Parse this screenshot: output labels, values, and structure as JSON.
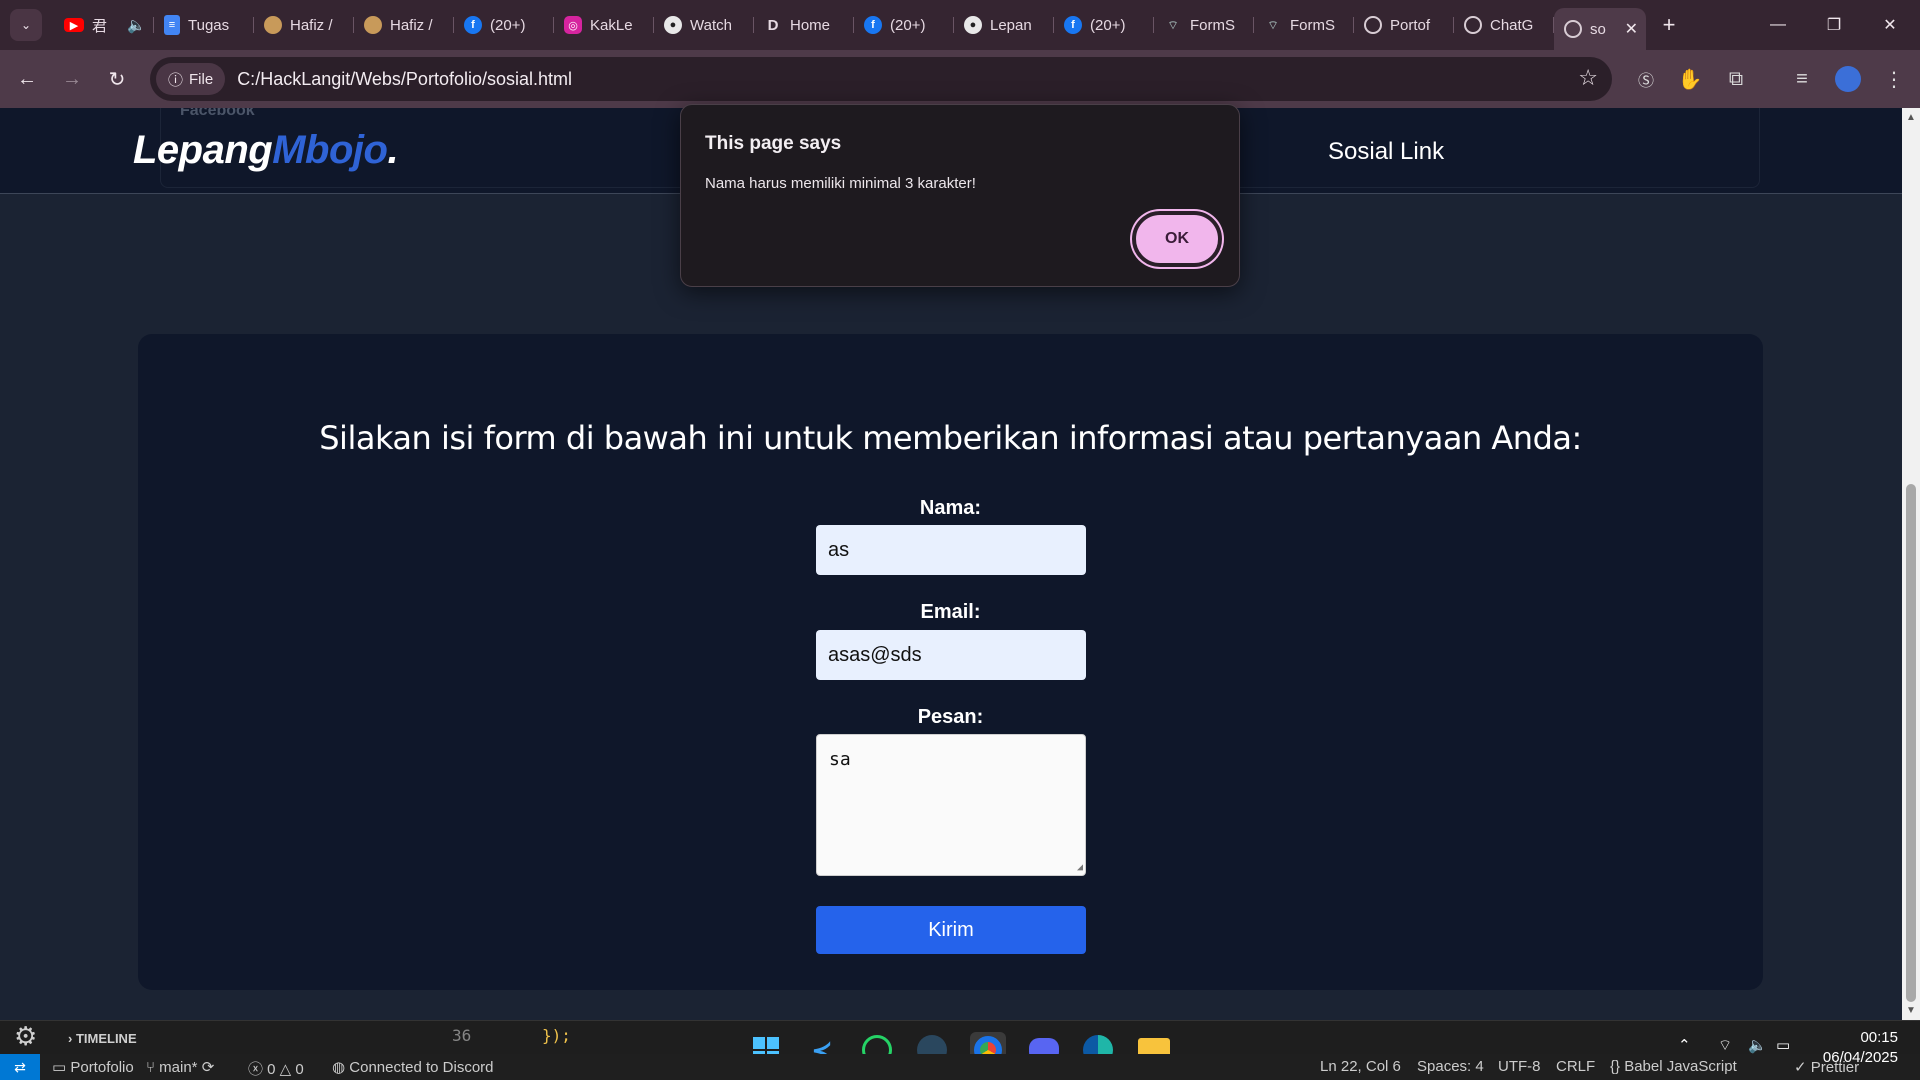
{
  "browser": {
    "tabs": [
      {
        "label": "君",
        "icon": "youtube-icon",
        "audio": true
      },
      {
        "label": "Tugas",
        "icon": "google-docs-icon"
      },
      {
        "label": "Hafiz /",
        "icon": "avatar-icon"
      },
      {
        "label": "Hafiz /",
        "icon": "avatar-icon"
      },
      {
        "label": "(20+)",
        "icon": "facebook-icon"
      },
      {
        "label": "KakLe",
        "icon": "instagram-icon"
      },
      {
        "label": "Watch",
        "icon": "github-icon"
      },
      {
        "label": "Home",
        "icon": "d-icon"
      },
      {
        "label": "(20+)",
        "icon": "facebook-icon"
      },
      {
        "label": "Lepan",
        "icon": "github-icon"
      },
      {
        "label": "(20+)",
        "icon": "facebook-icon"
      },
      {
        "label": "FormS",
        "icon": "form-icon"
      },
      {
        "label": "FormS",
        "icon": "form-icon"
      },
      {
        "label": "Portof",
        "icon": "globe-icon"
      },
      {
        "label": "ChatG",
        "icon": "chatgpt-icon"
      },
      {
        "label": "so",
        "icon": "globe-icon",
        "active": true
      }
    ],
    "address": {
      "scheme_chip": "File",
      "url": "C:/HackLangit/Webs/Portofolio/sosial.html"
    }
  },
  "page": {
    "logo": {
      "part1": "Lepang",
      "part2": "Mbojo",
      "part3": "."
    },
    "ghost_text": "Facebook",
    "nav_link": "Sosial Link",
    "heading": "Silakan isi form di bawah ini untuk memberikan informasi atau pertanyaan Anda:",
    "form": {
      "name_label": "Nama:",
      "name_value": "as",
      "email_label": "Email:",
      "email_value": "asas@sds",
      "message_label": "Pesan:",
      "message_value": "sa",
      "submit_label": "Kirim"
    }
  },
  "dialog": {
    "title": "This page says",
    "message": "Nama harus memiliki minimal 3 karakter!",
    "ok_label": "OK"
  },
  "editor": {
    "timeline_label": "TIMELINE",
    "line_number": "36",
    "code": "});"
  },
  "statusbar": {
    "project": "Portofolio",
    "branch": "main*",
    "errors": "0",
    "warnings": "0",
    "discord": "Connected to Discord",
    "position": "Ln 22, Col 6",
    "spaces": "Spaces: 4",
    "encoding": "UTF-8",
    "eol": "CRLF",
    "language": "Babel JavaScript",
    "formatter": "Prettier"
  },
  "clock": {
    "time": "00:15",
    "date": "06/04/2025"
  },
  "colors": {
    "tab_strip": "#352531",
    "toolbar": "#4e3a49",
    "page_bg": "#1b2333",
    "card_bg": "#0f172a",
    "accent_logo": "#2f63d6",
    "button_blue": "#2563eb",
    "dialog_ok": "#f1b6ec"
  }
}
